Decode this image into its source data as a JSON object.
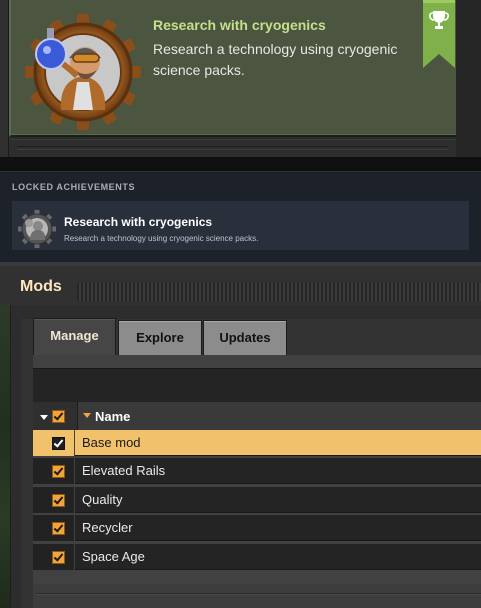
{
  "achievement_popup": {
    "title": "Research with cryogenics",
    "description": "Research a technology using cryogenic science packs.",
    "icon": "cryogenic-scientist-icon",
    "badge_icon": "trophy-icon",
    "colors": {
      "panel": "#4b5540",
      "title": "#c3e08c",
      "ribbon": "#7fb04a"
    }
  },
  "locked_achievements": {
    "heading": "LOCKED ACHIEVEMENTS",
    "items": [
      {
        "title": "Research with cryogenics",
        "description": "Research a technology using cryogenic science packs.",
        "icon": "cryogenic-scientist-icon"
      }
    ]
  },
  "mods_window": {
    "title": "Mods",
    "tabs": [
      {
        "label": "Manage",
        "active": true
      },
      {
        "label": "Explore",
        "active": false
      },
      {
        "label": "Updates",
        "active": false
      }
    ],
    "table": {
      "columns": {
        "enabled": "",
        "name": "Name"
      },
      "sort_icon": "sort-descending-icon",
      "rows": [
        {
          "name": "Base mod",
          "enabled": true,
          "selected": true
        },
        {
          "name": "Elevated Rails",
          "enabled": true,
          "selected": false
        },
        {
          "name": "Quality",
          "enabled": true,
          "selected": false
        },
        {
          "name": "Recycler",
          "enabled": true,
          "selected": false
        },
        {
          "name": "Space Age",
          "enabled": true,
          "selected": false
        }
      ]
    },
    "colors": {
      "accent": "#f0a43a",
      "selected_row": "#f2c16b",
      "title": "#ffe6c0"
    }
  }
}
